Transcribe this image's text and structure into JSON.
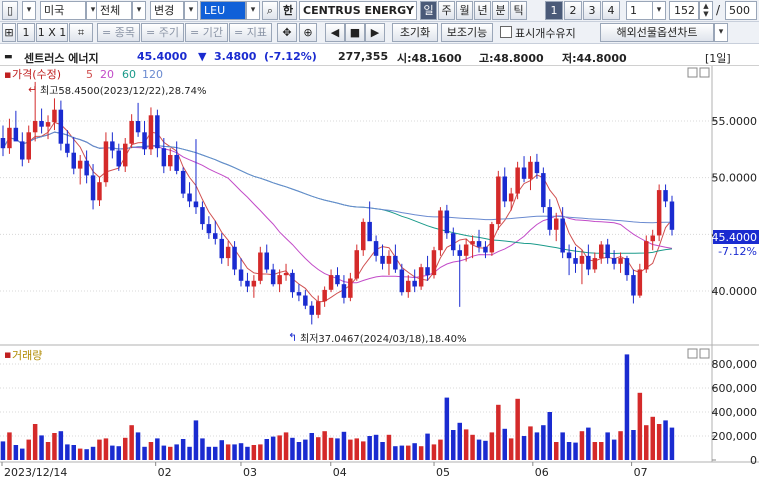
{
  "toolbar1": {
    "market": "미국",
    "category": "전체",
    "mode": "변경",
    "ticker": "LEU",
    "han_label": "한",
    "company": "CENTRUS ENERGY C",
    "periods": [
      "일",
      "주",
      "월",
      "년",
      "분",
      "틱"
    ],
    "selected_period": "일",
    "pages": [
      "1",
      "2",
      "3",
      "4"
    ],
    "interval": "1",
    "count": "152",
    "slash": "/",
    "total": "500"
  },
  "toolbar2": {
    "layouts": [
      "1",
      "1 X 1"
    ],
    "placeholders": [
      "종목",
      "주기",
      "기간",
      "지표"
    ],
    "reset_label": "초기화",
    "aux_label": "보조기능",
    "show_count_label": "표시개수유지",
    "show_count_checked": false,
    "futures_label": "해외선물옵션차트"
  },
  "quote": {
    "name": "센트러스 에너지",
    "price": "45.4000",
    "change_arrow": "▼",
    "change": "3.4800",
    "change_pct": "(-7.12%)",
    "volume": "277,355",
    "open": "시:48.1600",
    "high": "고:48.8000",
    "low": "저:44.8000",
    "period_tag": "[1일]"
  },
  "price_legend": {
    "title": "가격(수정)",
    "ma": [
      "5",
      "20",
      "60",
      "120"
    ]
  },
  "annotations": {
    "high_marker": "최고58.4500(2023/12/22),28.74%",
    "low_marker": "최저37.0467(2024/03/18),18.40%"
  },
  "price_axis": {
    "labels": [
      "55.0000",
      "50.0000",
      "45.0000",
      "40.0000"
    ],
    "current": "45.4000",
    "current_pct": "-7.12%"
  },
  "volume_legend": {
    "title": "거래량"
  },
  "volume_axis": {
    "labels": [
      "800,000",
      "600,000",
      "400,000",
      "200,000",
      "0"
    ]
  },
  "date_axis": {
    "labels": [
      "2023/12/14",
      "02",
      "03",
      "04",
      "05",
      "06",
      "07"
    ]
  },
  "colors": {
    "up": "#d42a2a",
    "down": "#1a2bd0",
    "ma5": "#d05050",
    "ma20": "#c24bc8",
    "ma60": "#1a9a8a",
    "ma120": "#6a8ad0"
  },
  "chart_data": {
    "type": "candlestick",
    "ylim": [
      35.5,
      59.5
    ],
    "volume_ylim": [
      0,
      900000
    ],
    "candles": [
      [
        53.5,
        54.6,
        51.9,
        52.6
      ],
      [
        52.6,
        55.2,
        52.1,
        54.4
      ],
      [
        54.4,
        55.9,
        53.5,
        53.2
      ],
      [
        53.2,
        54.0,
        51.0,
        51.6
      ],
      [
        51.6,
        54.6,
        51.3,
        54.0
      ],
      [
        54.0,
        58.45,
        53.2,
        55.0
      ],
      [
        55.0,
        56.1,
        53.9,
        54.5
      ],
      [
        54.5,
        55.5,
        53.4,
        54.9
      ],
      [
        54.9,
        57.0,
        54.2,
        56.0
      ],
      [
        56.0,
        56.8,
        52.4,
        53.0
      ],
      [
        53.0,
        54.2,
        51.8,
        52.2
      ],
      [
        52.2,
        53.6,
        50.3,
        50.8
      ],
      [
        50.8,
        52.0,
        49.4,
        51.5
      ],
      [
        51.5,
        52.4,
        49.5,
        50.2
      ],
      [
        50.2,
        51.2,
        47.2,
        48.0
      ],
      [
        48.0,
        50.1,
        47.5,
        49.6
      ],
      [
        49.6,
        54.0,
        49.2,
        53.2
      ],
      [
        53.2,
        54.0,
        51.7,
        52.4
      ],
      [
        52.4,
        53.0,
        50.6,
        51.0
      ],
      [
        51.0,
        53.5,
        50.5,
        53.0
      ],
      [
        53.0,
        55.6,
        52.6,
        55.0
      ],
      [
        55.0,
        56.6,
        53.6,
        54.0
      ],
      [
        54.0,
        55.0,
        52.0,
        52.5
      ],
      [
        52.5,
        56.2,
        52.0,
        55.5
      ],
      [
        55.5,
        56.0,
        51.8,
        52.6
      ],
      [
        52.6,
        53.5,
        50.4,
        51.0
      ],
      [
        51.0,
        52.6,
        50.6,
        52.0
      ],
      [
        52.0,
        53.2,
        50.3,
        50.6
      ],
      [
        50.6,
        50.9,
        48.2,
        48.6
      ],
      [
        48.6,
        49.6,
        47.4,
        47.9
      ],
      [
        47.9,
        53.4,
        46.8,
        47.4
      ],
      [
        47.4,
        47.9,
        45.4,
        45.9
      ],
      [
        45.9,
        46.6,
        44.6,
        45.1
      ],
      [
        45.1,
        46.2,
        44.1,
        44.6
      ],
      [
        44.6,
        45.1,
        42.4,
        42.9
      ],
      [
        42.9,
        44.4,
        42.2,
        43.9
      ],
      [
        43.9,
        44.4,
        41.4,
        41.9
      ],
      [
        41.9,
        42.9,
        40.4,
        40.9
      ],
      [
        40.9,
        41.6,
        39.9,
        40.4
      ],
      [
        40.4,
        41.4,
        39.4,
        40.9
      ],
      [
        40.9,
        43.9,
        40.6,
        43.4
      ],
      [
        43.4,
        44.1,
        41.6,
        41.9
      ],
      [
        41.9,
        42.4,
        40.4,
        40.6
      ],
      [
        40.6,
        41.9,
        39.9,
        41.4
      ],
      [
        41.4,
        42.4,
        40.9,
        41.6
      ],
      [
        41.6,
        41.9,
        39.4,
        39.9
      ],
      [
        39.9,
        40.6,
        39.1,
        39.6
      ],
      [
        39.6,
        40.1,
        38.4,
        38.7
      ],
      [
        38.7,
        39.1,
        37.05,
        37.9
      ],
      [
        37.9,
        39.6,
        37.6,
        39.1
      ],
      [
        39.1,
        40.4,
        38.6,
        40.1
      ],
      [
        40.1,
        41.9,
        39.9,
        41.4
      ],
      [
        41.4,
        42.1,
        40.4,
        40.6
      ],
      [
        40.6,
        41.4,
        38.9,
        39.4
      ],
      [
        39.4,
        41.6,
        39.1,
        41.1
      ],
      [
        41.1,
        44.1,
        40.9,
        43.6
      ],
      [
        43.6,
        46.4,
        43.1,
        46.1
      ],
      [
        46.1,
        47.9,
        45.4,
        44.4
      ],
      [
        44.4,
        44.9,
        42.6,
        43.1
      ],
      [
        43.1,
        44.1,
        41.9,
        42.4
      ],
      [
        42.4,
        43.6,
        41.4,
        43.1
      ],
      [
        43.1,
        44.1,
        41.6,
        41.9
      ],
      [
        41.9,
        42.4,
        39.6,
        39.9
      ],
      [
        39.9,
        41.4,
        39.4,
        40.9
      ],
      [
        40.9,
        41.9,
        39.9,
        40.4
      ],
      [
        40.4,
        42.4,
        40.1,
        42.1
      ],
      [
        42.1,
        43.1,
        40.9,
        41.4
      ],
      [
        41.4,
        43.9,
        41.1,
        43.6
      ],
      [
        43.6,
        47.4,
        43.1,
        47.1
      ],
      [
        47.1,
        47.6,
        44.6,
        45.1
      ],
      [
        45.1,
        45.6,
        43.1,
        43.6
      ],
      [
        43.6,
        44.1,
        38.6,
        43.1
      ],
      [
        43.1,
        44.6,
        42.6,
        44.1
      ],
      [
        44.1,
        44.9,
        42.9,
        44.4
      ],
      [
        44.4,
        45.4,
        43.4,
        43.9
      ],
      [
        43.9,
        44.4,
        42.9,
        43.4
      ],
      [
        43.4,
        46.1,
        43.1,
        45.9
      ],
      [
        45.9,
        50.6,
        45.4,
        50.1
      ],
      [
        50.1,
        50.9,
        47.4,
        47.9
      ],
      [
        47.9,
        49.1,
        47.1,
        48.6
      ],
      [
        48.6,
        51.4,
        48.1,
        50.9
      ],
      [
        50.9,
        51.9,
        49.6,
        49.9
      ],
      [
        49.9,
        51.9,
        48.9,
        51.4
      ],
      [
        51.4,
        52.1,
        49.9,
        50.4
      ],
      [
        50.4,
        50.9,
        46.9,
        47.4
      ],
      [
        47.4,
        48.1,
        44.9,
        45.4
      ],
      [
        45.4,
        46.9,
        44.4,
        46.4
      ],
      [
        46.4,
        47.4,
        42.9,
        43.4
      ],
      [
        43.4,
        44.1,
        41.4,
        42.9
      ],
      [
        42.9,
        43.9,
        41.6,
        42.4
      ],
      [
        42.4,
        43.6,
        40.6,
        43.1
      ],
      [
        43.1,
        44.1,
        41.4,
        41.9
      ],
      [
        41.9,
        43.4,
        41.6,
        42.9
      ],
      [
        42.9,
        44.4,
        42.4,
        44.1
      ],
      [
        44.1,
        44.6,
        42.4,
        42.9
      ],
      [
        42.9,
        43.6,
        41.9,
        42.4
      ],
      [
        42.4,
        43.4,
        41.6,
        42.9
      ],
      [
        42.9,
        43.1,
        40.9,
        41.4
      ],
      [
        41.4,
        41.9,
        38.9,
        39.6
      ],
      [
        39.6,
        42.4,
        39.4,
        41.9
      ],
      [
        41.9,
        44.9,
        41.6,
        44.4
      ],
      [
        44.4,
        45.4,
        43.6,
        44.9
      ],
      [
        44.9,
        49.4,
        44.4,
        48.9
      ],
      [
        48.9,
        49.4,
        47.4,
        47.9
      ],
      [
        47.9,
        48.4,
        44.9,
        45.4
      ]
    ],
    "volumes": [
      155000,
      230000,
      125000,
      95000,
      170000,
      300000,
      205000,
      150000,
      225000,
      240000,
      130000,
      125000,
      95000,
      90000,
      110000,
      170000,
      180000,
      120000,
      115000,
      185000,
      290000,
      230000,
      110000,
      150000,
      180000,
      120000,
      110000,
      130000,
      175000,
      110000,
      330000,
      180000,
      110000,
      110000,
      165000,
      130000,
      130000,
      140000,
      110000,
      125000,
      130000,
      175000,
      195000,
      205000,
      230000,
      185000,
      150000,
      170000,
      225000,
      190000,
      240000,
      185000,
      180000,
      235000,
      170000,
      180000,
      155000,
      200000,
      210000,
      150000,
      210000,
      115000,
      120000,
      120000,
      140000,
      115000,
      220000,
      130000,
      170000,
      520000,
      250000,
      310000,
      255000,
      210000,
      170000,
      160000,
      230000,
      460000,
      260000,
      180000,
      510000,
      200000,
      280000,
      230000,
      290000,
      400000,
      150000,
      230000,
      150000,
      145000,
      240000,
      270000,
      150000,
      150000,
      230000,
      170000,
      240000,
      880000,
      250000,
      560000,
      290000,
      360000,
      300000,
      330000,
      270000
    ]
  }
}
